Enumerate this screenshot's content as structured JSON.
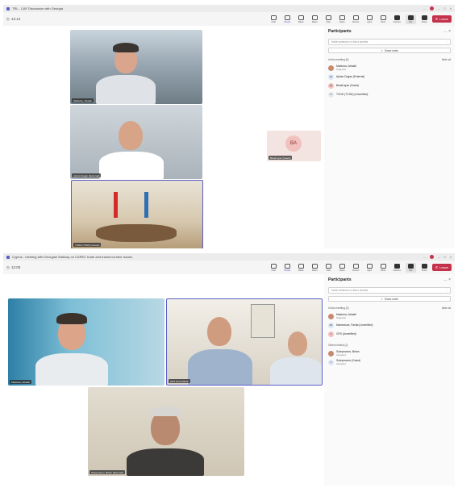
{
  "window1": {
    "title": "TRL - CAF Discussion with Georgia",
    "titlebar_right": "...",
    "timer": "12:14",
    "toolbar": [
      {
        "label": "Chat",
        "icon": "chat-icon"
      },
      {
        "label": "People",
        "icon": "people-icon"
      },
      {
        "label": "Raise",
        "icon": "raise-hand-icon"
      },
      {
        "label": "React",
        "icon": "react-icon"
      },
      {
        "label": "View",
        "icon": "view-icon"
      },
      {
        "label": "Notes",
        "icon": "notes-icon"
      },
      {
        "label": "Rooms",
        "icon": "rooms-icon"
      },
      {
        "label": "Apps",
        "icon": "apps-icon"
      },
      {
        "label": "More",
        "icon": "more-icon"
      },
      {
        "label": "Camera",
        "icon": "camera-icon"
      },
      {
        "label": "Mic",
        "icon": "mic-icon"
      },
      {
        "label": "Share",
        "icon": "share-icon"
      }
    ],
    "leave": "Leave",
    "tiles": [
      {
        "caption": "Markulov, Arkadii"
      },
      {
        "caption": "Ayhan Dogan (External)"
      },
      {
        "caption": "TCDD (TCDD) (Guest)"
      }
    ],
    "avatar_tile": {
      "initials": "BA",
      "caption": "Binali Ayaz (Guest)"
    },
    "panel": {
      "title": "Participants",
      "invite_placeholder": "Invite someone or dial a number",
      "share_label": "Share invite",
      "section": "In this meeting (5)",
      "section_action": "Mute all",
      "people": [
        {
          "name": "Markulov, Arkadii",
          "role": "Organizer",
          "initials": ""
        },
        {
          "name": "Ayhan Dogan (External)",
          "role": "",
          "initials": "AD"
        },
        {
          "name": "Binali Ayaz (Guest)",
          "role": "",
          "initials": "BA"
        },
        {
          "name": "TCDD (TCDD) (Unverified)",
          "role": "",
          "initials": "TT"
        }
      ]
    }
  },
  "window2": {
    "title": "Cyprus - meeting with Georgian Railway on CAREC trade and transit corridor issues",
    "titlebar_right": "...",
    "timer": "12:00",
    "toolbar": [
      {
        "label": "Chat",
        "icon": "chat-icon"
      },
      {
        "label": "People",
        "icon": "people-icon"
      },
      {
        "label": "Raise",
        "icon": "raise-hand-icon"
      },
      {
        "label": "React",
        "icon": "react-icon"
      },
      {
        "label": "View",
        "icon": "view-icon"
      },
      {
        "label": "Notes",
        "icon": "notes-icon"
      },
      {
        "label": "Rooms",
        "icon": "rooms-icon"
      },
      {
        "label": "Apps",
        "icon": "apps-icon"
      },
      {
        "label": "More",
        "icon": "more-icon"
      },
      {
        "label": "Camera",
        "icon": "camera-icon"
      },
      {
        "label": "Mic",
        "icon": "mic-icon"
      },
      {
        "label": "Share",
        "icon": "share-icon"
      }
    ],
    "leave": "Leave",
    "tiles": [
      {
        "caption": "Markulov, Arkadii"
      },
      {
        "caption": "GFS (Unverified)"
      },
      {
        "caption": "Suleymanov, Ilkhan (External)"
      }
    ],
    "panel": {
      "title": "Participants",
      "invite_placeholder": "Invite someone or dial a number",
      "share_label": "Share invite",
      "section": "In this meeting (3)",
      "section_action": "Mute all",
      "people": [
        {
          "name": "Markulov, Arkadii",
          "role": "Organizer",
          "initials": ""
        },
        {
          "name": "Mamedova, Farida (Unverified)",
          "role": "",
          "initials": "MF"
        },
        {
          "name": "GFS (Unverified)",
          "role": "",
          "initials": "G"
        }
      ],
      "section2": "Others invited (2)",
      "people2": [
        {
          "name": "Suleymanov, Ilkhan",
          "role": "Accepted",
          "initials": ""
        },
        {
          "name": "Suleymanov (Guest)",
          "role": "Accepted",
          "initials": "S"
        }
      ]
    }
  }
}
